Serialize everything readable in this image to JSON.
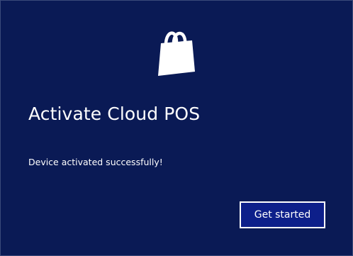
{
  "dialog": {
    "icon": "shopping-bag-icon",
    "title": "Activate Cloud POS",
    "message": "Device activated successfully!",
    "primary_button_label": "Get started"
  },
  "colors": {
    "background": "#0a1a55",
    "button_background": "#0d1f8a",
    "text": "#ffffff"
  }
}
